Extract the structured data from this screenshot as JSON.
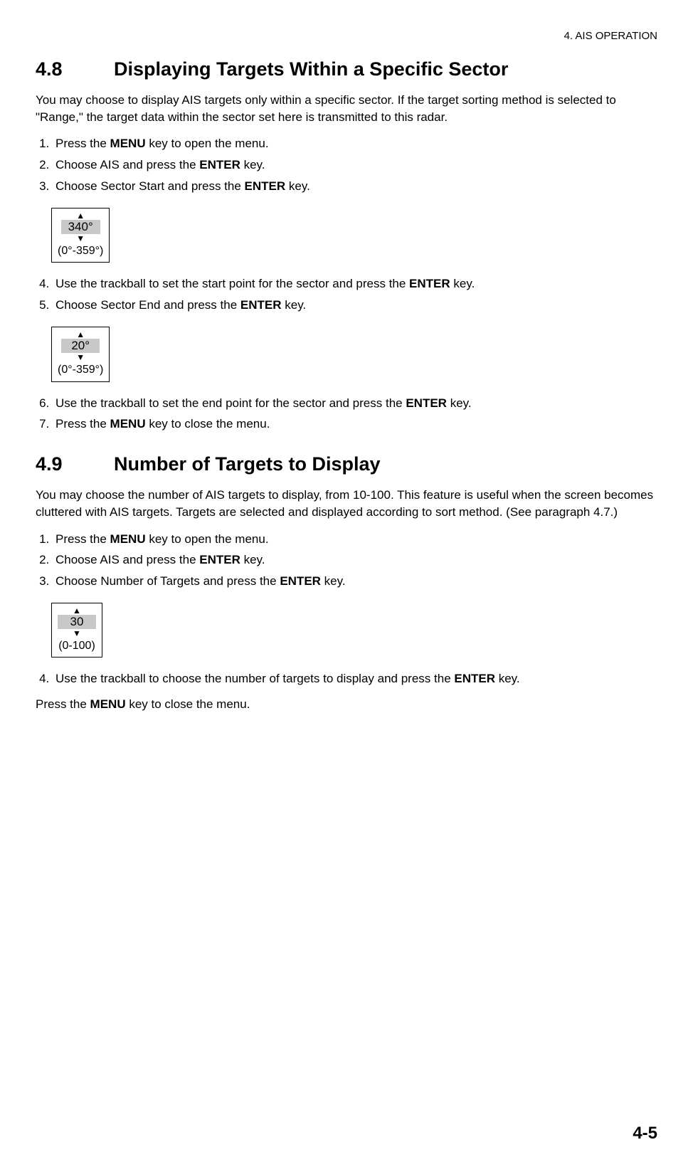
{
  "header": {
    "chapter": "4. AIS OPERATION"
  },
  "section48": {
    "number": "4.8",
    "title": "Displaying Targets Within a Specific Sector",
    "intro": "You may choose to display AIS targets only within a specific sector. If the target sorting method is selected to \"Range,\" the target data within the sector set here is transmitted to this radar.",
    "steps_a": {
      "s1a": "Press the ",
      "s1b": "MENU",
      "s1c": " key to open the menu.",
      "s2a": "Choose AIS and press the ",
      "s2b": "ENTER",
      "s2c": " key.",
      "s3a": "Choose Sector Start and press the ",
      "s3b": "ENTER",
      "s3c": " key."
    },
    "spinner1": {
      "value": "340°",
      "range": "(0°-359°)"
    },
    "steps_b": {
      "s4a": "Use the trackball to set the start point for the sector and press the ",
      "s4b": "ENTER",
      "s4c": " key.",
      "s5a": "Choose Sector End and press the ",
      "s5b": "ENTER",
      "s5c": " key."
    },
    "spinner2": {
      "value": "20°",
      "range": "(0°-359°)"
    },
    "steps_c": {
      "s6a": "Use the trackball to set the end point for the sector and press the ",
      "s6b": "ENTER",
      "s6c": " key.",
      "s7a": "Press the ",
      "s7b": "MENU",
      "s7c": " key to close the menu."
    }
  },
  "section49": {
    "number": "4.9",
    "title": "Number of Targets to Display",
    "intro": "You may choose the number of AIS targets to display, from 10-100. This feature is useful when the screen becomes cluttered with AIS targets. Targets are selected and displayed according to sort method. (See paragraph 4.7.)",
    "steps_a": {
      "s1a": "Press the ",
      "s1b": "MENU",
      "s1c": " key to open the menu.",
      "s2a": "Choose AIS and press the ",
      "s2b": "ENTER",
      "s2c": " key.",
      "s3a": "Choose Number of Targets and press the ",
      "s3b": "ENTER",
      "s3c": " key."
    },
    "spinner": {
      "value": "30",
      "range": "(0-100)"
    },
    "steps_b": {
      "s4a": "Use the trackball to choose the number of targets to display and press the ",
      "s4b": "ENTER",
      "s4c": " key."
    },
    "closing_a": "Press the ",
    "closing_b": "MENU",
    "closing_c": " key to close the menu."
  },
  "footer": {
    "page": "4-5"
  }
}
